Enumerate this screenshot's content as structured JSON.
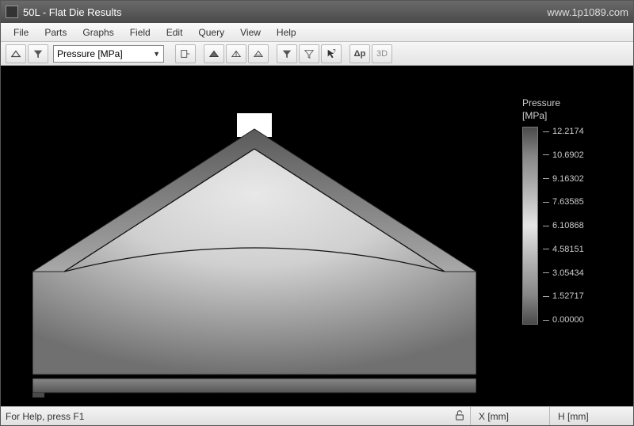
{
  "window": {
    "title": "50L - Flat Die Results",
    "watermark": "www.1p1089.com"
  },
  "menu": {
    "items": [
      "File",
      "Parts",
      "Graphs",
      "Field",
      "Edit",
      "Query",
      "View",
      "Help"
    ]
  },
  "toolbar": {
    "field_select": "Pressure [MPa]",
    "dp_label": "Δp",
    "3d_label": "3D"
  },
  "legend": {
    "title_line1": "Pressure",
    "title_line2": "[MPa]",
    "values": [
      "12.2174",
      "10.6902",
      "9.16302",
      "7.63585",
      "6.10868",
      "4.58151",
      "3.05434",
      "1.52717",
      "0.00000"
    ]
  },
  "statusbar": {
    "help": "For Help, press F1",
    "x_label": "X [mm]",
    "h_label": "H [mm]"
  },
  "chart_data": {
    "type": "heatmap",
    "title": "Pressure [MPa]",
    "field": "Pressure",
    "unit": "MPa",
    "range": [
      0.0,
      12.2174
    ],
    "colorbar_ticks": [
      12.2174,
      10.6902,
      9.16302,
      7.63585,
      6.10868,
      4.58151,
      3.05434,
      1.52717,
      0.0
    ],
    "geometry": "flat-die-cross-section",
    "notes": "Grayscale pressure distribution over flat die; higher pressure near inlet apex, decreasing toward exit slit."
  }
}
